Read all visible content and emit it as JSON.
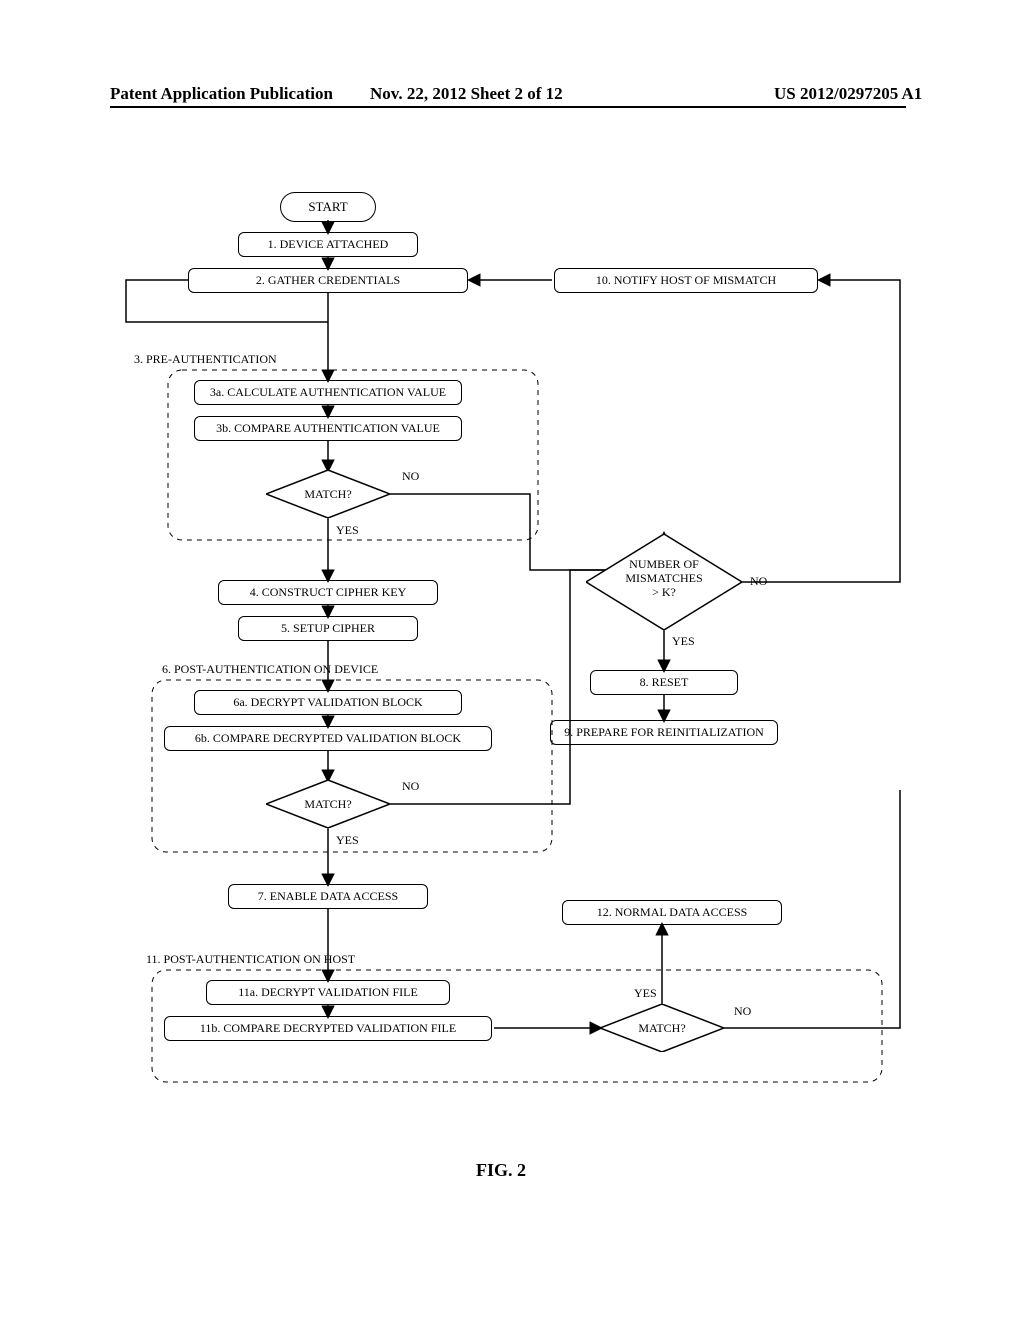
{
  "header": {
    "left": "Patent Application Publication",
    "mid": "Nov. 22, 2012  Sheet 2 of 12",
    "right": "US 2012/0297205 A1"
  },
  "nodes": {
    "start": "START",
    "s1": "1. DEVICE ATTACHED",
    "s2": "2. GATHER CREDENTIALS",
    "g3": "3. PRE-AUTHENTICATION",
    "s3a": "3a. CALCULATE AUTHENTICATION VALUE",
    "s3b": "3b. COMPARE AUTHENTICATION VALUE",
    "d3": "MATCH?",
    "s4": "4. CONSTRUCT CIPHER KEY",
    "s5": "5. SETUP CIPHER",
    "g6": "6. POST-AUTHENTICATION ON DEVICE",
    "s6a": "6a. DECRYPT VALIDATION BLOCK",
    "s6b": "6b. COMPARE DECRYPTED VALIDATION BLOCK",
    "d6": "MATCH?",
    "s7": "7. ENABLE DATA ACCESS",
    "s8": "8. RESET",
    "s9": "9. PREPARE FOR REINITIALIZATION",
    "s10": "10. NOTIFY HOST OF MISMATCH",
    "dK": "NUMBER OF\nMISMATCHES\n> K?",
    "g11": "11. POST-AUTHENTICATION ON HOST",
    "s11a": "11a. DECRYPT VALIDATION FILE",
    "s11b": "11b. COMPARE DECRYPTED VALIDATION FILE",
    "d11": "MATCH?",
    "s12": "12. NORMAL DATA ACCESS"
  },
  "labels": {
    "yes": "YES",
    "no": "NO"
  },
  "figure": "FIG. 2"
}
